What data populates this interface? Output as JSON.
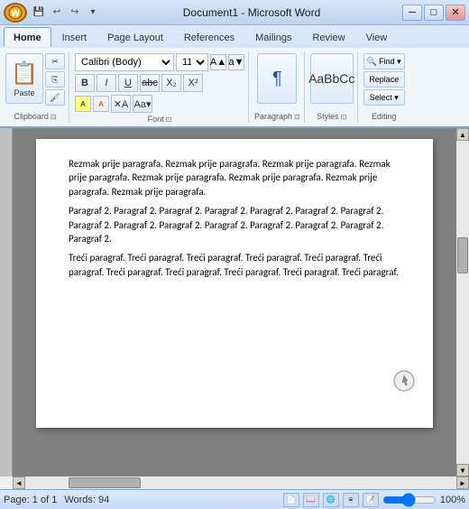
{
  "titlebar": {
    "title": "Document1 - Microsoft Word",
    "min_btn": "─",
    "max_btn": "□",
    "close_btn": "✕"
  },
  "ribbon": {
    "tabs": [
      {
        "label": "Home",
        "active": true
      },
      {
        "label": "Insert",
        "active": false
      },
      {
        "label": "Page Layout",
        "active": false
      },
      {
        "label": "References",
        "active": false
      },
      {
        "label": "Mailings",
        "active": false
      },
      {
        "label": "Review",
        "active": false
      },
      {
        "label": "View",
        "active": false
      }
    ],
    "clipboard": {
      "paste_label": "Paste",
      "cut_label": "✂",
      "copy_label": "⎘",
      "format_label": "🖌",
      "group_label": "Clipboard"
    },
    "font": {
      "font_name": "Calibri (Body)",
      "font_size": "11",
      "bold": "B",
      "italic": "I",
      "underline": "U",
      "strikethrough": "abc",
      "subscript": "X₂",
      "superscript": "X²",
      "clear": "A",
      "grow": "A",
      "shrink": "a",
      "highlight": "A",
      "color": "A",
      "group_label": "Font"
    },
    "paragraph": {
      "icon": "¶",
      "label": "Paragraph"
    },
    "styles": {
      "label": "Styles",
      "icon": "AaBbCc"
    },
    "editing": {
      "label": "Editing",
      "find": "Find ▾",
      "replace": "Replace",
      "select": "Select ▾"
    }
  },
  "document": {
    "paragraphs": [
      "Rezmak prije paragrafa. Rezmak prije paragrafa. Rezmak prije paragrafa. Rezmak prije paragrafa. Rezmak prije paragrafa. Rezmak prije paragrafa. Rezmak prije paragrafa. Rezmak prije paragrafa.",
      "Paragraf 2. Paragraf 2. Paragraf 2. Paragraf 2. Paragraf 2. Paragraf 2. Paragraf 2. Paragraf 2. Paragraf 2. Paragraf 2. Paragraf 2. Paragraf 2. Paragraf 2. Paragraf 2. Paragraf 2.",
      "Treći paragraf. Treći paragraf. Treći paragraf. Treći paragraf. Treći paragraf. Treći paragraf. Treći paragraf. Treći paragraf. Treći paragraf. Treći paragraf. Treći paragraf."
    ]
  },
  "statusbar": {
    "page": "Page: 1 of 1",
    "words": "Words: 94",
    "zoom": "100%"
  }
}
